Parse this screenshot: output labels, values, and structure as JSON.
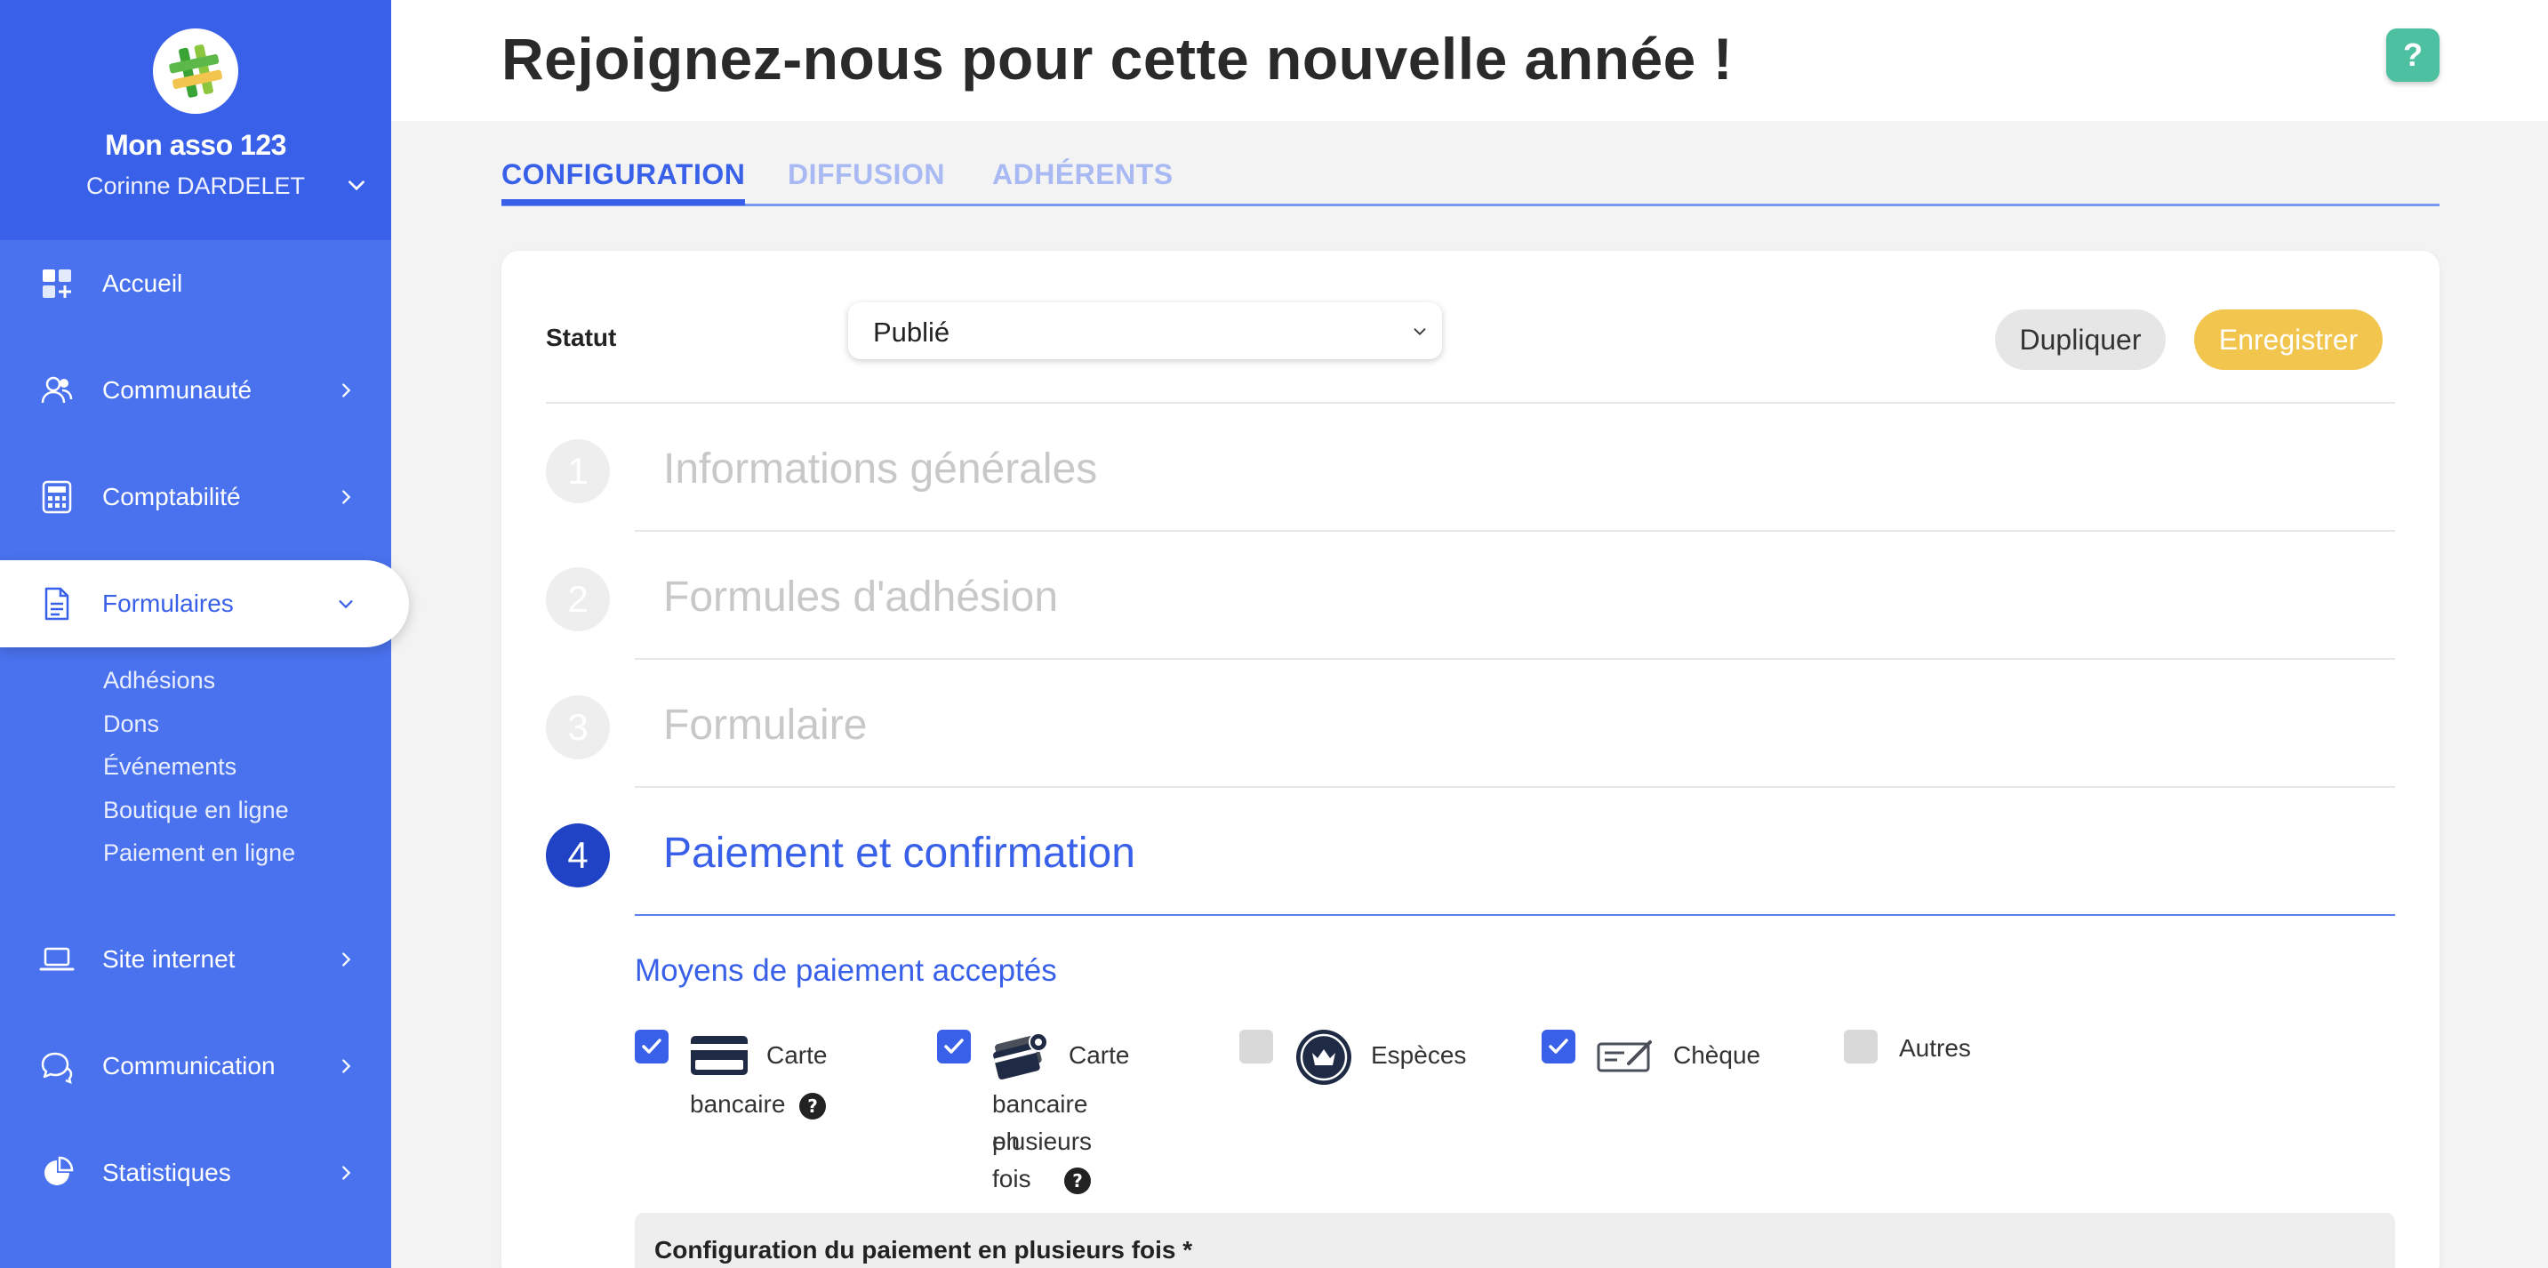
{
  "sidebar": {
    "org_name": "Mon asso 123",
    "user_name": "Corinne DARDELET",
    "items": [
      {
        "label": "Accueil",
        "icon": "dashboard-icon"
      },
      {
        "label": "Communauté",
        "icon": "users-icon"
      },
      {
        "label": "Comptabilité",
        "icon": "calculator-icon"
      },
      {
        "label": "Formulaires",
        "icon": "document-icon"
      },
      {
        "label": "Site internet",
        "icon": "laptop-icon"
      },
      {
        "label": "Communication",
        "icon": "chat-icon"
      },
      {
        "label": "Statistiques",
        "icon": "pie-chart-icon"
      }
    ],
    "sub_items": [
      "Adhésions",
      "Dons",
      "Événements",
      "Boutique en ligne",
      "Paiement en ligne"
    ]
  },
  "header": {
    "title": "Rejoignez-nous pour cette nouvelle année !",
    "help_label": "?"
  },
  "tabs": [
    {
      "label": "CONFIGURATION",
      "active": true
    },
    {
      "label": "DIFFUSION",
      "active": false
    },
    {
      "label": "ADHÉRENTS",
      "active": false
    }
  ],
  "status": {
    "label": "Statut",
    "value": "Publié"
  },
  "actions": {
    "duplicate": "Dupliquer",
    "save": "Enregistrer"
  },
  "steps": [
    {
      "number": "1",
      "title": "Informations générales"
    },
    {
      "number": "2",
      "title": "Formules d'adhésion"
    },
    {
      "number": "3",
      "title": "Formulaire"
    },
    {
      "number": "4",
      "title": "Paiement et confirmation"
    }
  ],
  "payment": {
    "section_title": "Moyens de paiement acceptés",
    "options": [
      {
        "line1": "Carte",
        "line2": "bancaire",
        "line3": "",
        "checked": true,
        "icon": "credit-card-icon"
      },
      {
        "line1": "Carte",
        "line2": "bancaire en",
        "line3": "plusieurs fois",
        "checked": true,
        "icon": "multi-card-icon"
      },
      {
        "line1": "Espèces",
        "checked": false,
        "icon": "coin-icon"
      },
      {
        "line1": "Chèque",
        "checked": true,
        "icon": "cheque-icon"
      },
      {
        "line1": "Autres",
        "checked": false
      }
    ],
    "config_title": "Configuration du paiement en plusieurs fois *"
  },
  "colors": {
    "sidebar": "#4a72ee",
    "sidebar_header": "#3960e8",
    "accent": "#3960e8",
    "save": "#f2c54e",
    "help": "#4cc0a0"
  }
}
